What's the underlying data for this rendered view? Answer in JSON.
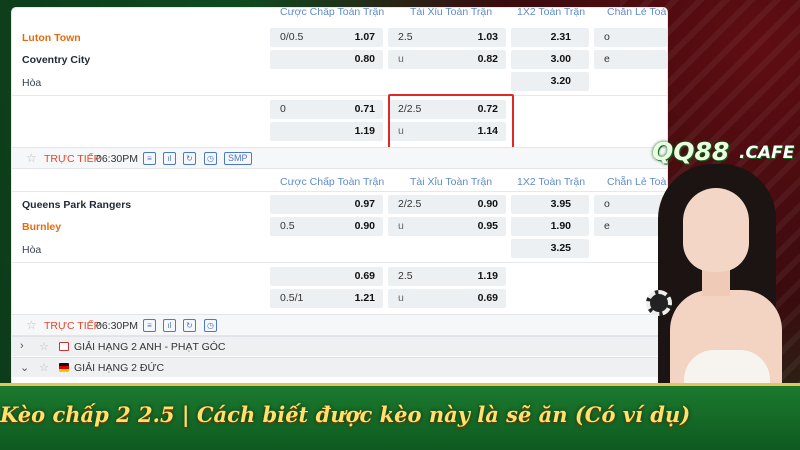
{
  "brand": {
    "logo_main": "QQ88",
    "logo_sub": ".CAFE"
  },
  "banner": {
    "title": "Kèo chấp 2 2.5 | Cách biết được kèo này là sẽ ăn (Có ví dụ)"
  },
  "columns": {
    "handicap": "Cược Chấp Toàn Trận",
    "overunder": "Tài Xỉu Toàn Trận",
    "x12": "1X2 Toàn Trận",
    "oddeven": "Chẵn Lẻ Toà"
  },
  "match1": {
    "home": "Luton Town",
    "away": "Coventry City",
    "draw": "Hòa",
    "row1": {
      "hc_line": "0/0.5",
      "hc_odds": "1.07",
      "ou_line": "2.5",
      "ou_odds": "1.03",
      "x12": "2.31",
      "oe": "o"
    },
    "row2": {
      "hc_odds": "0.80",
      "ou_line": "u",
      "ou_odds": "0.82",
      "x12": "3.00",
      "oe": "e"
    },
    "row3": {
      "x12": "3.20"
    },
    "alt1": {
      "hc_line": "0",
      "hc_odds": "0.71",
      "ou_line": "2/2.5",
      "ou_odds": "0.72"
    },
    "alt2": {
      "hc_odds": "1.19",
      "ou_line": "u",
      "ou_odds": "1.14"
    },
    "status": {
      "live": "TRỰC TIẾP",
      "time": "06:30PM",
      "smp": "SMP"
    }
  },
  "match2": {
    "home": "Queens Park Rangers",
    "away": "Burnley",
    "draw": "Hòa",
    "row1": {
      "hc_odds": "0.97",
      "ou_line": "2/2.5",
      "ou_odds": "0.90",
      "x12": "3.95",
      "oe": "o"
    },
    "row2": {
      "hc_line": "0.5",
      "hc_odds": "0.90",
      "ou_line": "u",
      "ou_odds": "0.95",
      "x12": "1.90",
      "oe": "e"
    },
    "row3": {
      "x12": "3.25"
    },
    "alt1": {
      "hc_odds": "0.69",
      "ou_line": "2.5",
      "ou_odds": "1.19"
    },
    "alt2": {
      "hc_line": "0.5/1",
      "hc_odds": "1.21",
      "ou_line": "u",
      "ou_odds": "0.69"
    },
    "status": {
      "live": "TRỰC TIẾP",
      "time": "06:30PM"
    }
  },
  "leagues": [
    {
      "name": "GIẢI HẠNG 2 ANH - PHẠT GÓC",
      "expanded": false
    },
    {
      "name": "GIẢI HẠNG 2 ĐỨC",
      "expanded": true
    }
  ],
  "colors": {
    "favorite": "#e86a10",
    "live": "#e6462c",
    "highlight": "#e12727",
    "banner_text": "#ffe16b"
  },
  "icons": [
    "star-icon",
    "scoreboard-icon",
    "stats-icon",
    "refresh-icon",
    "clock-icon"
  ]
}
